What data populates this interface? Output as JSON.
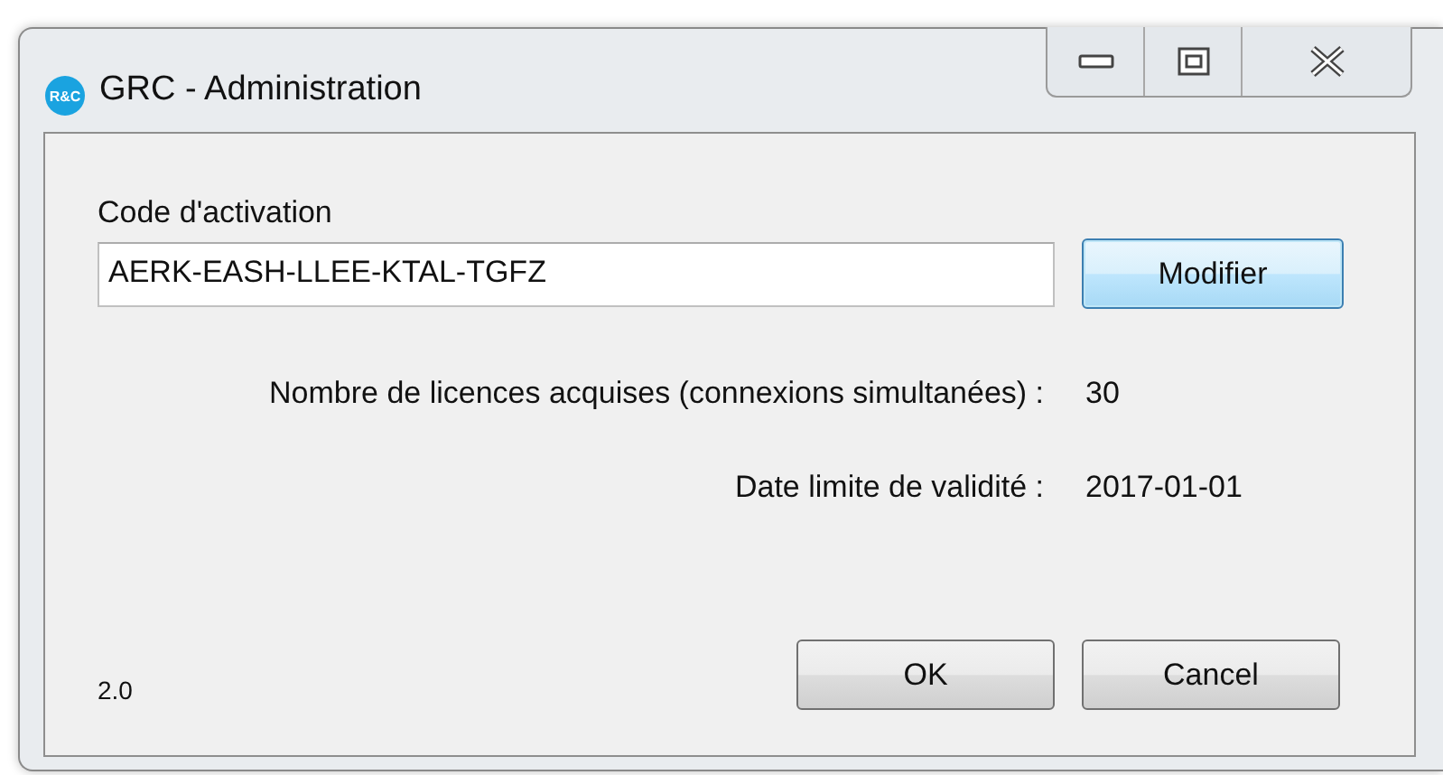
{
  "window": {
    "title": "GRC - Administration",
    "logo": "R&C"
  },
  "activation": {
    "label": "Code d'activation",
    "value": "AERK-EASH-LLEE-KTAL-TGFZ",
    "button": "Modifier"
  },
  "info_rows": [
    {
      "label": "Nombre de licences acquises (connexions simultanées) :",
      "value": "30"
    },
    {
      "label": "Date limite de validité :",
      "value": "2017-01-01"
    }
  ],
  "version": "2.0",
  "buttons": [
    "OK",
    "Cancel"
  ]
}
